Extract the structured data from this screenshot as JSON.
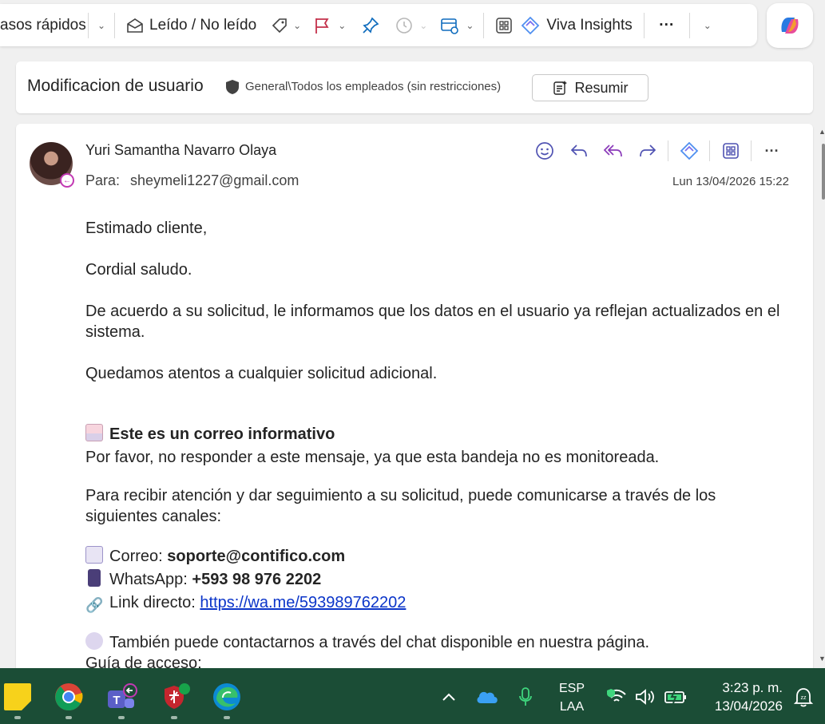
{
  "toolbar": {
    "quick_steps_label": "asos rápidos",
    "read_unread_label": "Leído / No leído",
    "viva_insights_label": "Viva Insights",
    "more_label": "···"
  },
  "subject": {
    "title": "Modificacion de usuario",
    "sensitivity_label": "General\\Todos los empleados (sin restricciones)",
    "summarize_label": "Resumir"
  },
  "message": {
    "sender": "Yuri Samantha Navarro Olaya",
    "to_prefix": "Para:",
    "to_address": "sheymeli1227@gmail.com",
    "date": "Lun 13/04/2026 15:22",
    "body": {
      "greeting": "Estimado cliente,",
      "salutation": "Cordial saludo.",
      "p1": "De acuerdo a su solicitud, le informamos que los datos en el usuario ya reflejan actualizados en el sistema.",
      "p2": "Quedamos atentos a cualquier solicitud adicional.",
      "info_heading": "Este es un correo informativo",
      "info_text": "Por favor, no responder a este mensaje, ya que esta bandeja no es monitoreada.",
      "p3": "Para recibir atención y dar seguimiento a su solicitud, puede comunicarse a través de los siguientes canales:",
      "email_label": "Correo:",
      "email_value": "soporte@contifico.com",
      "whatsapp_label": "WhatsApp:",
      "whatsapp_value": "+593 98 976 2202",
      "link_label": "Link directo:",
      "link_value": "https://wa.me/593989762202",
      "chat_text": "También puede contactarnos a través del chat disponible en nuestra página.",
      "guide_text": "Guía de acceso:"
    }
  },
  "taskbar": {
    "lang_top": "ESP",
    "lang_bottom": "LAA",
    "time": "3:23 p. m.",
    "date": "13/04/2026"
  }
}
